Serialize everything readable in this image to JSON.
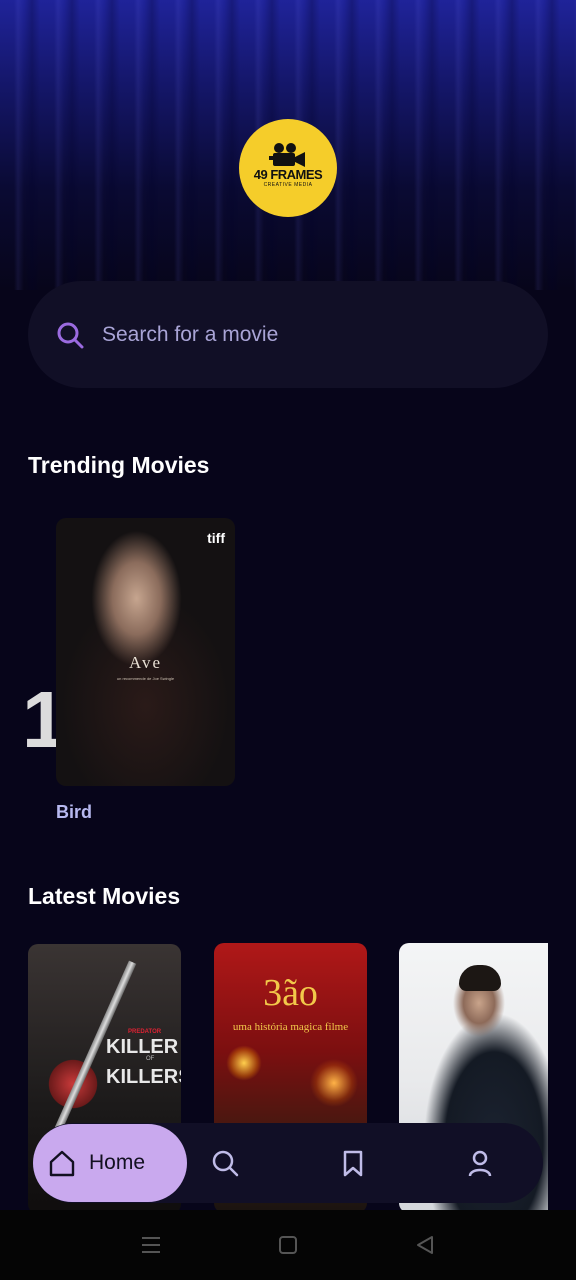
{
  "header": {
    "logo": {
      "brand": "49 FRAMES",
      "tagline": "CREATIVE MEDIA",
      "icon": "movie-camera-icon",
      "color": "#f5cd2a"
    }
  },
  "search": {
    "placeholder": "Search for a movie",
    "icon": "search-icon"
  },
  "trending": {
    "title": "Trending Movies",
    "items": [
      {
        "rank": "1",
        "name": "Bird",
        "poster_title": "Ave",
        "poster_subtitle": "un recommende de Joe Swingle",
        "poster_badge": "tiff"
      }
    ]
  },
  "latest": {
    "title": "Latest Movies",
    "items": [
      {
        "poster_text_top": "PREDATOR",
        "poster_text_1": "KILLER",
        "poster_text_2": "OF",
        "poster_text_3": "KILLERS"
      },
      {
        "poster_title": "3ão",
        "poster_subtitle": "uma história magica filme"
      },
      {
        "poster_title": ""
      }
    ]
  },
  "bottom_nav": {
    "active_color": "#c9a9ee",
    "items": [
      {
        "label": "Home",
        "icon": "home-icon"
      },
      {
        "label": "",
        "icon": "search-icon"
      },
      {
        "label": "",
        "icon": "bookmark-icon"
      },
      {
        "label": "",
        "icon": "profile-icon"
      }
    ]
  },
  "system_bar": {
    "items": [
      "menu-icon",
      "home-square-icon",
      "back-triangle-icon"
    ]
  }
}
